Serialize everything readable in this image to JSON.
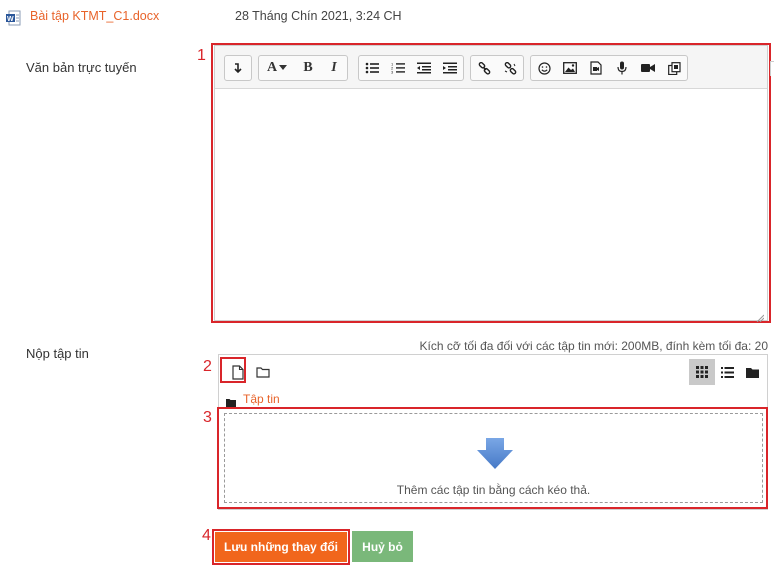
{
  "file_row": {
    "filename": "Bài tập KTMT_C1.docx",
    "date": "28 Tháng Chín 2021, 3:24 CH"
  },
  "online_text": {
    "label": "Văn bản trực tuyến",
    "toolbar_icons": [
      "collapse-icon",
      "font-color-icon",
      "bold-icon",
      "italic-icon",
      "unordered-list-icon",
      "ordered-list-icon",
      "outdent-icon",
      "indent-icon",
      "link-icon",
      "unlink-icon",
      "emoji-icon",
      "image-icon",
      "media-icon",
      "record-audio-icon",
      "record-video-icon",
      "manage-files-icon"
    ],
    "font_button": "A",
    "bold_button": "B",
    "italic_button": "I"
  },
  "file_submission": {
    "label": "Nộp tập tin",
    "size_note": "Kích cỡ tối đa đối với các tập tin mới: 200MB, đính kèm tối đa: 20",
    "breadcrumb": "Tập tin",
    "drop_text": "Thêm các tập tin bằng cách kéo thả."
  },
  "annotations": [
    "1",
    "2",
    "3",
    "4"
  ],
  "buttons": {
    "save": "Lưu những thay đổi",
    "cancel": "Huỷ bỏ"
  },
  "colors": {
    "accent": "#e8632a",
    "save_bg": "#f1661c",
    "cancel_bg": "#7ab87a",
    "annotation_red": "#d9252a",
    "dropzone_arrow": "#5b8fd6"
  }
}
